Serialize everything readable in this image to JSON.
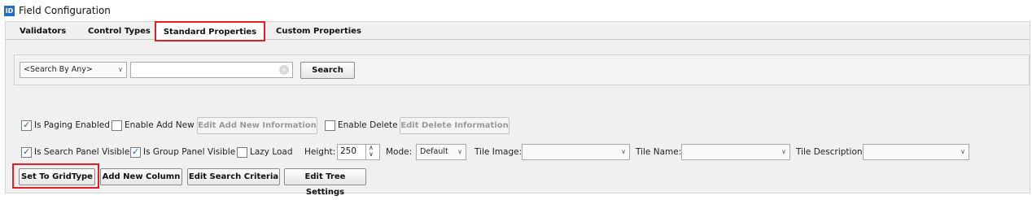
{
  "window": {
    "app_icon": "ID",
    "title": "Field Configuration"
  },
  "tabs": [
    {
      "label": "Validators"
    },
    {
      "label": "Control Types"
    },
    {
      "label": "Standard Properties"
    },
    {
      "label": "Custom Properties"
    }
  ],
  "search": {
    "filter_value": "<Search By Any>",
    "input_value": "",
    "button_label": "Search",
    "clear_icon": "clear-icon"
  },
  "options_row1": {
    "paging_label": "Is Paging Enabled",
    "paging_checked": true,
    "add_new_label": "Enable Add New",
    "add_new_checked": false,
    "edit_add_new_button": "Edit Add New Information",
    "delete_label": "Enable Delete",
    "delete_checked": false,
    "edit_delete_button": "Edit Delete Information"
  },
  "options_row2": {
    "search_panel_label": "Is Search Panel Visible",
    "search_panel_checked": true,
    "group_panel_label": "Is Group Panel Visible",
    "group_panel_checked": true,
    "lazy_load_label": "Lazy Load",
    "lazy_load_checked": false,
    "height_label": "Height:",
    "height_value": "250",
    "mode_label": "Mode:",
    "mode_value": "Default",
    "tile_image_label": "Tile Image:",
    "tile_image_value": "",
    "tile_name_label": "Tile Name:",
    "tile_name_value": "",
    "tile_description_label": "Tile Description:",
    "tile_description_value": ""
  },
  "actions": {
    "set_to_gridtype": "Set To GridType",
    "add_new_column": "Add New Column",
    "edit_search_criteria": "Edit Search Criteria",
    "edit_tree_settings": "Edit Tree Settings"
  },
  "colors": {
    "highlight": "#e31e24",
    "app_icon_bg": "#1f6fc7",
    "check_color": "#1a5fb4"
  }
}
